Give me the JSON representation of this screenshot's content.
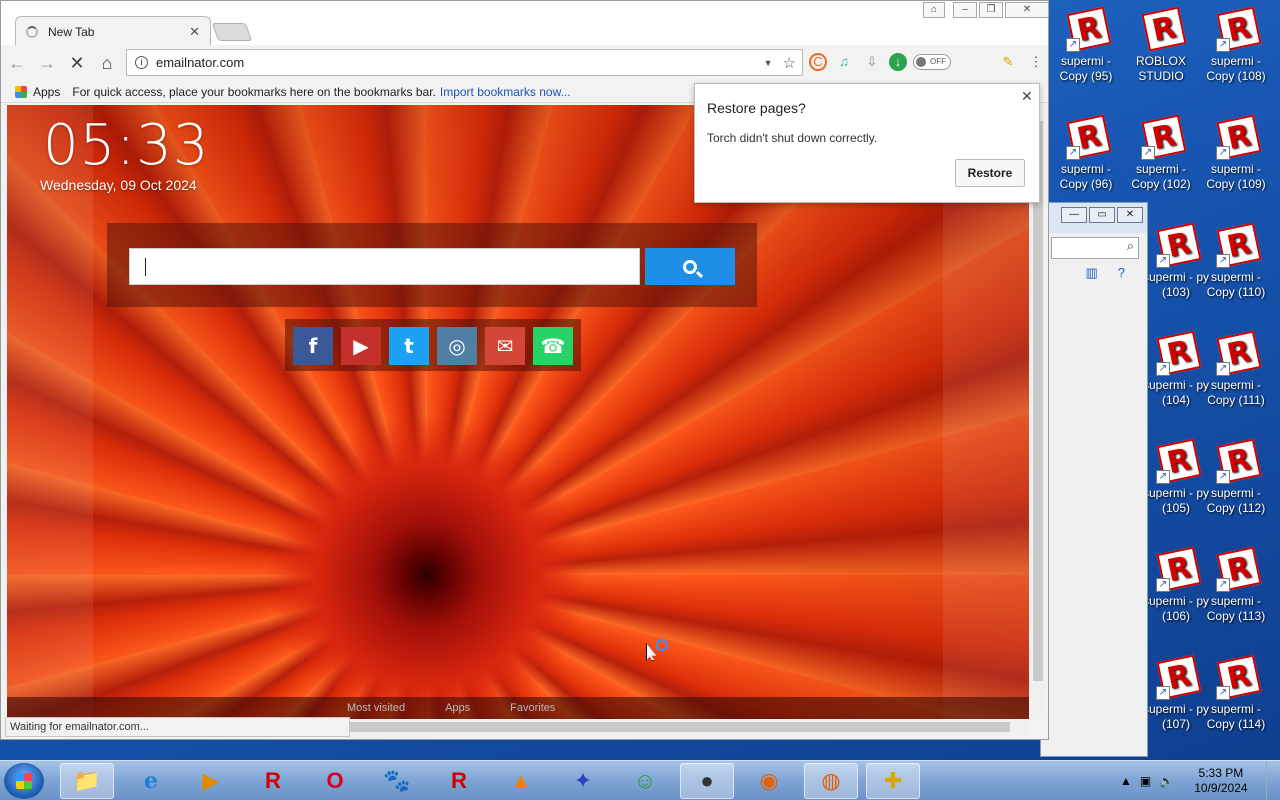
{
  "browser": {
    "tab_title": "New Tab",
    "url": "emailnator.com",
    "bookmarks_apps": "Apps",
    "bookmarks_hint": "For quick access, place your bookmarks here on the bookmarks bar.",
    "bookmarks_import": "Import bookmarks now...",
    "status_text": "Waiting for emailnator.com...",
    "toggle_label": "OFF"
  },
  "newtab": {
    "clock": "05:33",
    "date": "Wednesday,  09 Oct 2024",
    "social": [
      "f",
      "▶",
      "t",
      "◎",
      "✉",
      "☎"
    ],
    "social_colors": [
      "#3b5998",
      "#c4302b",
      "#1da1f2",
      "#517fa4",
      "#d44638",
      "#25d366"
    ],
    "bottom_links": [
      "Most visited",
      "Apps",
      "Favorites"
    ]
  },
  "popup": {
    "title": "Restore pages?",
    "message": "Torch didn't shut down correctly.",
    "button": "Restore"
  },
  "desktop_icons": [
    {
      "label": "supermi - Copy (95)"
    },
    {
      "label": "ROBLOX STUDIO"
    },
    {
      "label": "supermi - Copy (108)"
    },
    {
      "label": "supermi - Copy (96)"
    },
    {
      "label": "supermi - Copy (102)"
    },
    {
      "label": "supermi - Copy (109)"
    },
    {
      "label": "supermi - py (103)"
    },
    {
      "label": "supermi - Copy (110)"
    },
    {
      "label": "supermi - py (104)"
    },
    {
      "label": "supermi - Copy (111)"
    },
    {
      "label": "supermi - py (105)"
    },
    {
      "label": "supermi - Copy (112)"
    },
    {
      "label": "supermi - py (106)"
    },
    {
      "label": "supermi - Copy (113)"
    },
    {
      "label": "supermi - py (107)"
    },
    {
      "label": "supermi - Copy (114)"
    }
  ],
  "taskbar": {
    "time": "5:33 PM",
    "date": "10/9/2024",
    "apps": [
      "explorer-icon",
      "internet-explorer-icon",
      "media-player-icon",
      "roblox-icon",
      "opera-icon",
      "gimp-icon",
      "roblox-studio-icon",
      "vlc-icon",
      "bird-app-icon",
      "messenger-icon",
      "angry-bird-icon",
      "firefox-icon",
      "torch-icon",
      "puzzle-app-icon"
    ]
  }
}
